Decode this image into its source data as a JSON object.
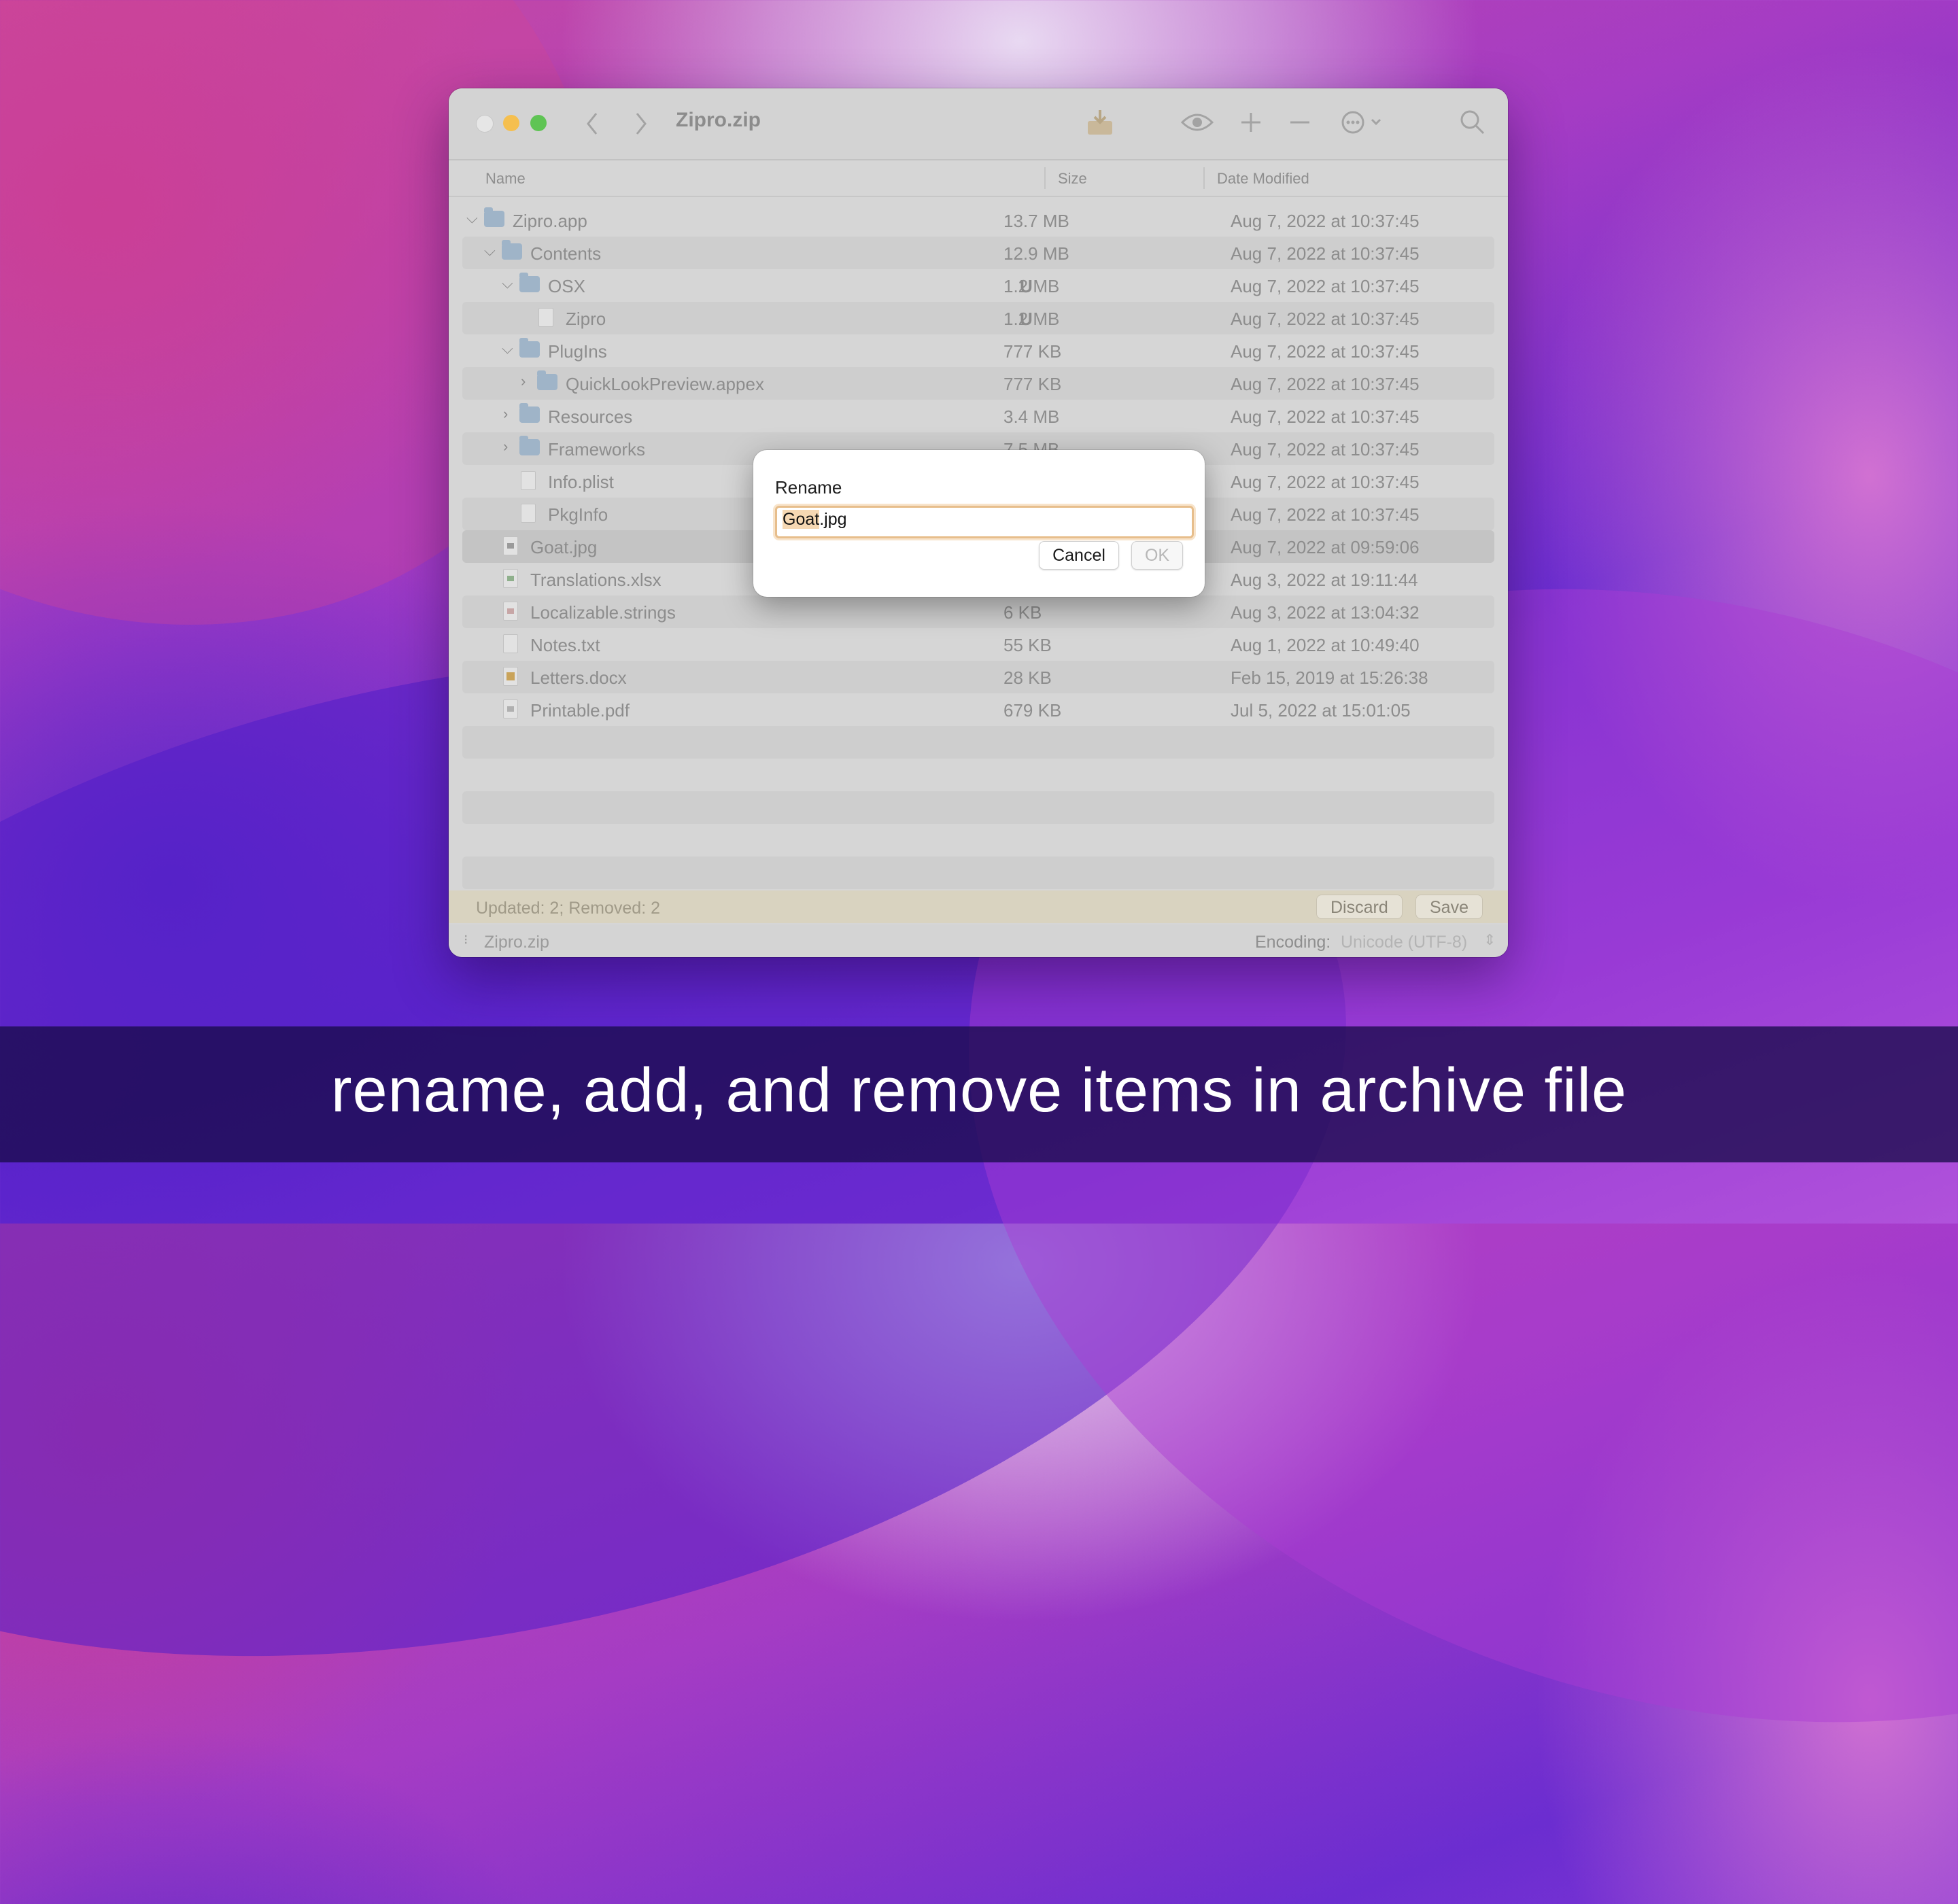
{
  "window": {
    "title": "Zipro.zip",
    "icons": [
      "chevron-left-icon",
      "chevron-right-icon",
      "extract-icon",
      "eye-icon",
      "plus-icon",
      "minus-icon",
      "more-icon",
      "search-icon"
    ]
  },
  "columns": {
    "name": "Name",
    "size": "Size",
    "date": "Date Modified"
  },
  "files": [
    {
      "name": "Zipro.app",
      "badge": "",
      "size": "13.7 MB",
      "date": "Aug 7, 2022 at 10:37:45"
    },
    {
      "name": "Contents",
      "badge": "",
      "size": "12.9 MB",
      "date": "Aug 7, 2022 at 10:37:45"
    },
    {
      "name": "OSX",
      "badge": "U",
      "size": "1.2 MB",
      "date": "Aug 7, 2022 at 10:37:45"
    },
    {
      "name": "Zipro",
      "badge": "U",
      "size": "1.2 MB",
      "date": "Aug 7, 2022 at 10:37:45"
    },
    {
      "name": "PlugIns",
      "badge": "",
      "size": "777 KB",
      "date": "Aug 7, 2022 at 10:37:45"
    },
    {
      "name": "QuickLookPreview.appex",
      "badge": "",
      "size": "777 KB",
      "date": "Aug 7, 2022 at 10:37:45"
    },
    {
      "name": "Resources",
      "badge": "",
      "size": "3.4 MB",
      "date": "Aug 7, 2022 at 10:37:45"
    },
    {
      "name": "Frameworks",
      "badge": "",
      "size": "7.5 MB",
      "date": "Aug 7, 2022 at 10:37:45"
    },
    {
      "name": "Info.plist",
      "badge": "",
      "size": "",
      "date": "Aug 7, 2022 at 10:37:45"
    },
    {
      "name": "PkgInfo",
      "badge": "",
      "size": "",
      "date": "Aug 7, 2022 at 10:37:45"
    },
    {
      "name": "Goat.jpg",
      "badge": "",
      "size": "",
      "date": "Aug 7, 2022 at 09:59:06"
    },
    {
      "name": "Translations.xlsx",
      "badge": "",
      "size": "",
      "date": "Aug 3, 2022 at 19:11:44"
    },
    {
      "name": "Localizable.strings",
      "badge": "",
      "size": "6 KB",
      "date": "Aug 3, 2022 at 13:04:32"
    },
    {
      "name": "Notes.txt",
      "badge": "",
      "size": "55 KB",
      "date": "Aug 1, 2022 at 10:49:40"
    },
    {
      "name": "Letters.docx",
      "badge": "",
      "size": "28 KB",
      "date": "Feb 15, 2019 at 15:26:38"
    },
    {
      "name": "Printable.pdf",
      "badge": "",
      "size": "679 KB",
      "date": "Jul 5, 2022 at 15:01:05"
    }
  ],
  "status": {
    "text": "Updated: 2; Removed: 2",
    "discard": "Discard",
    "save": "Save"
  },
  "bottom": {
    "archive": "Zipro.zip",
    "encoding_label": "Encoding:",
    "encoding_value": "Unicode (UTF-8)"
  },
  "dialog": {
    "title": "Rename",
    "value_selected": "Goat",
    "value_rest": ".jpg",
    "cancel": "Cancel",
    "ok": "OK"
  },
  "caption": "rename, add, and remove items in archive file"
}
